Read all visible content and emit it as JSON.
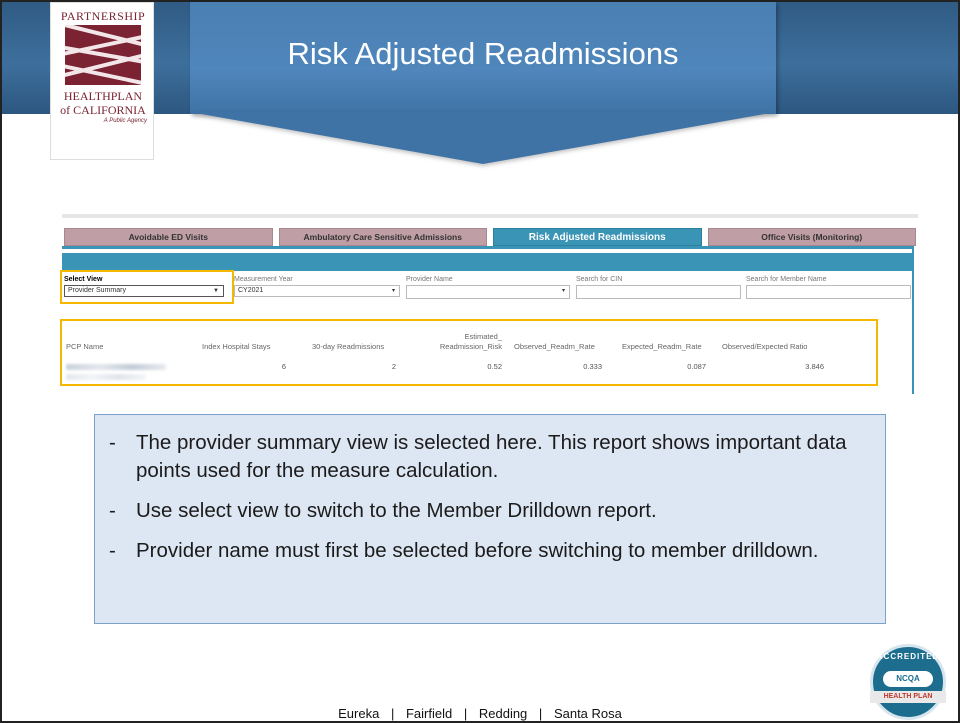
{
  "slide": {
    "title": "Risk Adjusted Readmissions"
  },
  "logo": {
    "top_text": "PARTNERSHIP",
    "line1": "HEALTHPLAN",
    "line2": "of CALIFORNIA",
    "tagline": "A Public Agency"
  },
  "dashboard": {
    "tabs": [
      {
        "label": "Avoidable ED Visits",
        "active": false
      },
      {
        "label": "Ambulatory Care Sensitive Admissions",
        "active": false
      },
      {
        "label": "Risk Adjusted Readmissions",
        "active": true
      },
      {
        "label": "Office Visits (Monitoring)",
        "active": false
      }
    ],
    "filters": {
      "select_view": {
        "label": "Select View",
        "value": "Provider Summary"
      },
      "measurement_year": {
        "label": "Measurement Year",
        "value": "CY2021"
      },
      "provider_name": {
        "label": "Provider Name",
        "value": ""
      },
      "search_cin": {
        "label": "Search for CIN",
        "value": ""
      },
      "search_member": {
        "label": "Search for Member Name",
        "value": ""
      }
    },
    "table": {
      "headers": {
        "pcp_name": "PCP Name",
        "index_stays": "Index Hospital Stays",
        "readmissions_30": "30-day Readmissions",
        "est_risk_1": "Estimated_",
        "est_risk_2": "Readmission_Risk",
        "observed": "Observed_Readm_Rate",
        "expected": "Expected_Readm_Rate",
        "ratio": "Observed/Expected Ratio"
      },
      "rows": [
        {
          "index_stays": "6",
          "readmissions_30": "2",
          "est_risk": "0.52",
          "observed": "0.333",
          "expected": "0.087",
          "ratio": "3.846"
        }
      ]
    },
    "colors": {
      "tab_active": "#3a94b5",
      "tab_inactive": "#bf9ea6",
      "highlight": "#f5b800"
    }
  },
  "callout": {
    "bullets": [
      "The provider summary view is selected here. This report shows important data points used for the measure calculation.",
      "Use select view to switch to the Member Drilldown report.",
      "Provider name must first be selected before switching to member drilldown."
    ],
    "dash": "-"
  },
  "footer": {
    "locations": [
      "Eureka",
      "Fairfield",
      "Redding",
      "Santa Rosa"
    ],
    "separator": "|"
  },
  "seal": {
    "ring": "ACCREDITED",
    "mid": "NCQA",
    "band": "HEALTH PLAN"
  }
}
